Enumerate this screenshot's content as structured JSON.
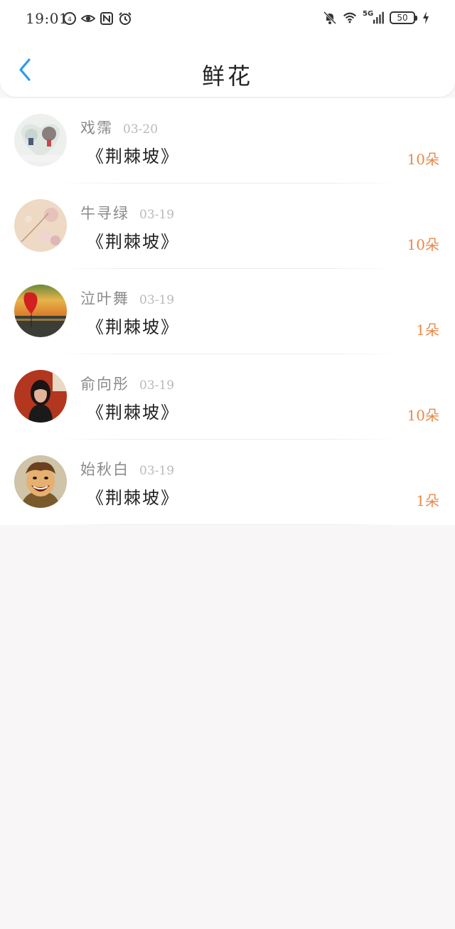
{
  "status_bar": {
    "time": "19:01",
    "network": "5G",
    "battery": "50",
    "icons_left": [
      "data-saver-icon",
      "eye-icon",
      "nfc-icon",
      "alarm-icon"
    ],
    "icons_right": [
      "bell-off-icon",
      "wifi-icon",
      "signal-icon",
      "battery-icon",
      "charging-icon"
    ]
  },
  "header": {
    "title": "鲜花",
    "back_icon": "chevron-left-icon",
    "accent_color": "#2b9bef"
  },
  "flowers": [
    {
      "name": "戏霈",
      "date": "03-20",
      "book": "《荆棘坡》",
      "count": "10朵",
      "avatar": "couple-photo"
    },
    {
      "name": "牛寻绿",
      "date": "03-19",
      "book": "《荆棘坡》",
      "count": "10朵",
      "avatar": "floral-painting"
    },
    {
      "name": "泣叶舞",
      "date": "03-19",
      "book": "《荆棘坡》",
      "count": "1朵",
      "avatar": "sunset-heart-balloon"
    },
    {
      "name": "俞向彤",
      "date": "03-19",
      "book": "《荆棘坡》",
      "count": "10朵",
      "avatar": "girl-portrait"
    },
    {
      "name": "始秋白",
      "date": "03-19",
      "book": "《荆棘坡》",
      "count": "1朵",
      "avatar": "cartoon-laughing-man"
    }
  ],
  "colors": {
    "count_orange": "#e8894a",
    "name_gray": "#8a8a8a",
    "date_gray": "#b9b9b9",
    "page_background": "#f8f6f7"
  }
}
